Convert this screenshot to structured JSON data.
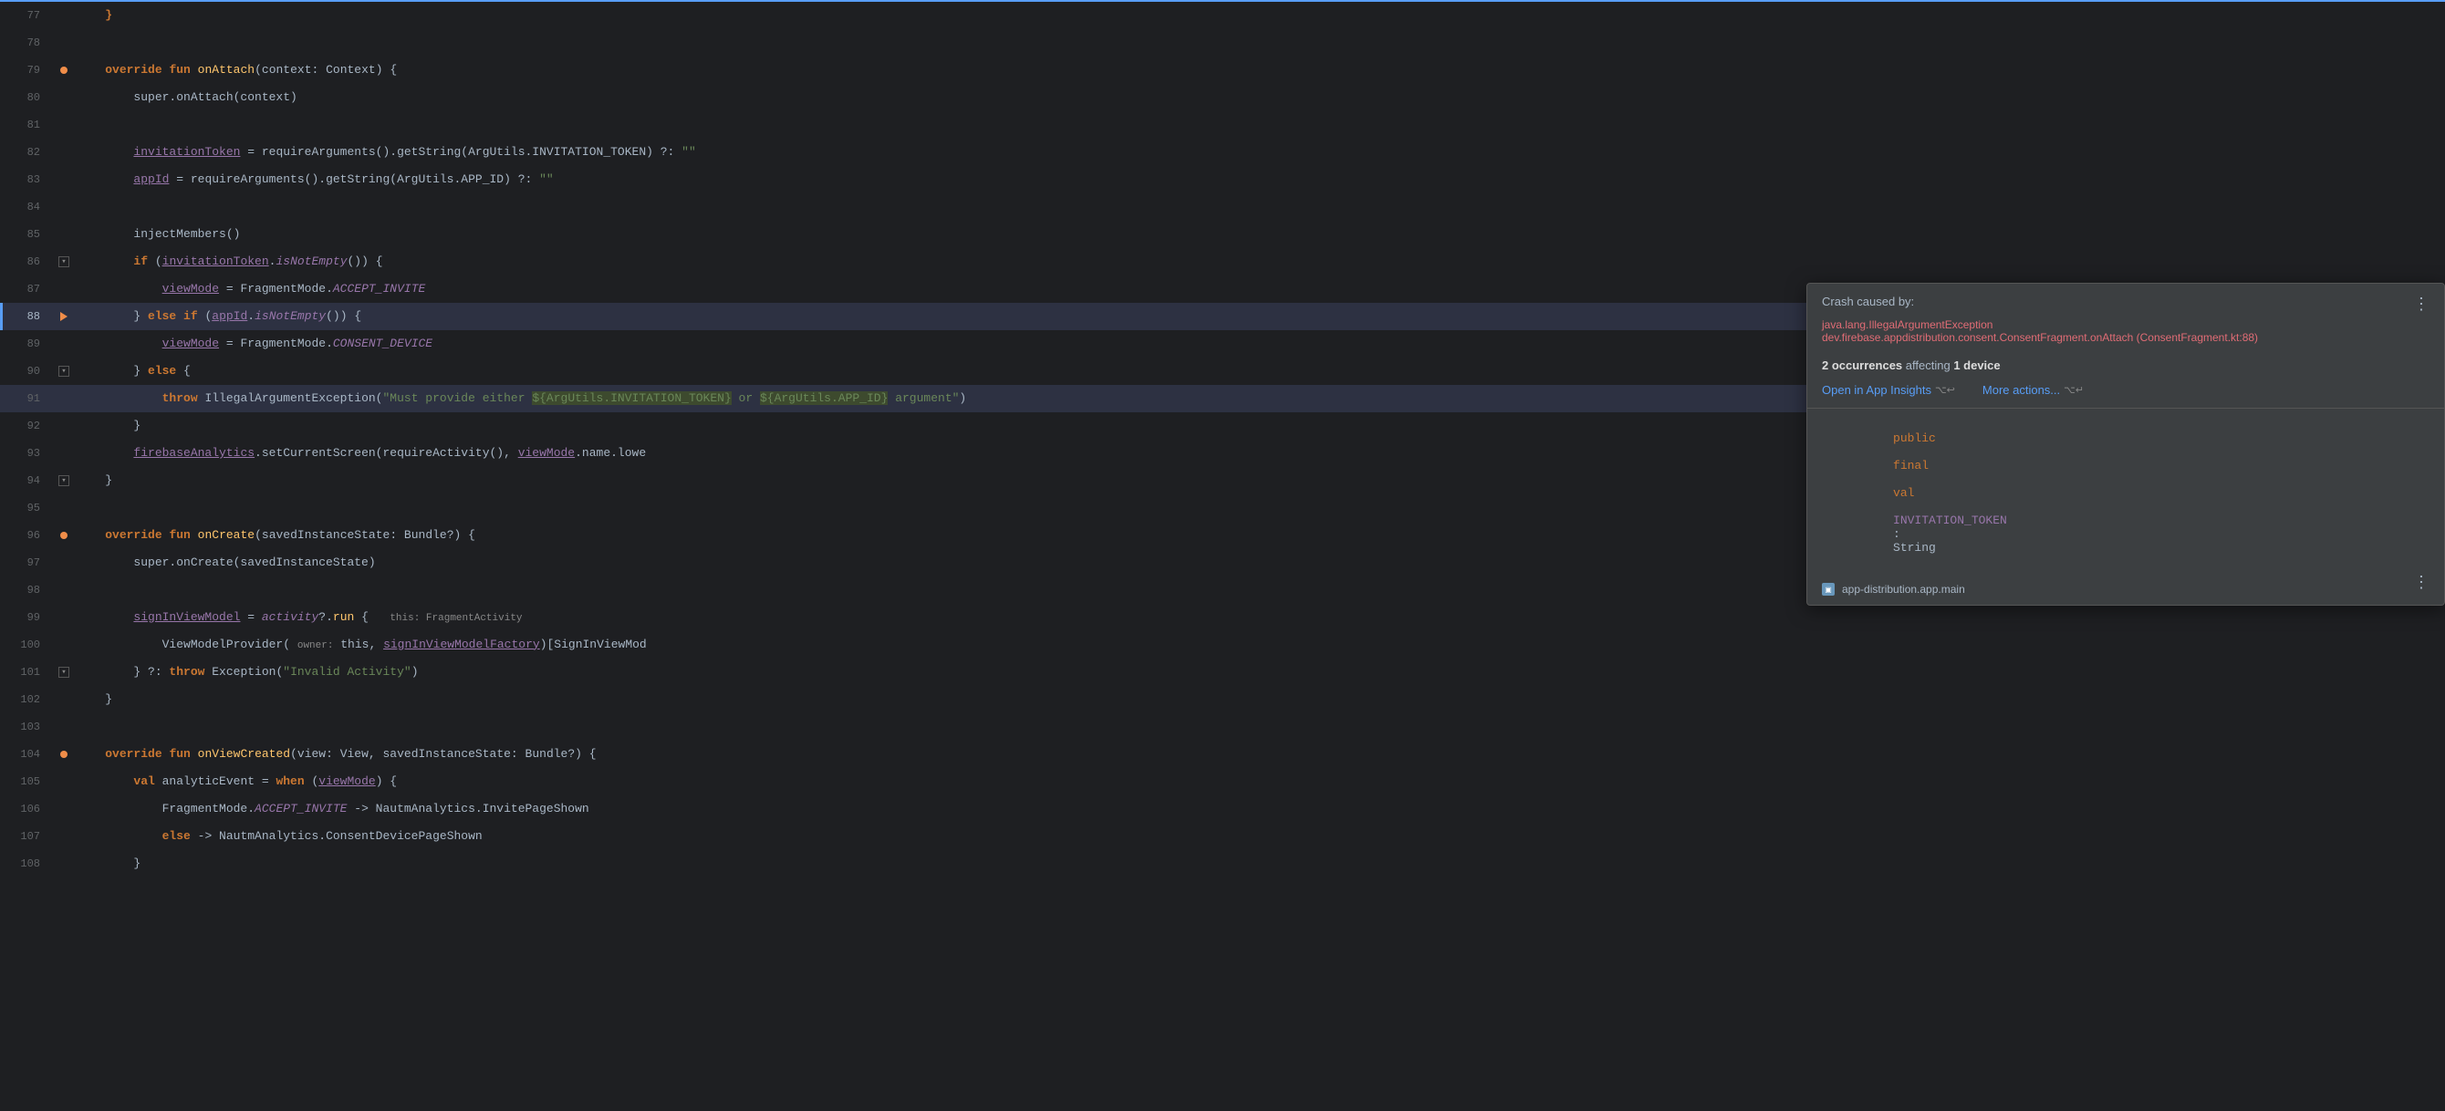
{
  "editor": {
    "lines": [
      {
        "num": "77",
        "gutter": "none",
        "content_html": "    }"
      },
      {
        "num": "78",
        "gutter": "none",
        "content_html": ""
      },
      {
        "num": "79",
        "gutter": "dot-orange",
        "content_html": "    <kw>override</kw> <kw>fun</kw> <fn>onAttach</fn>(context: Context) {"
      },
      {
        "num": "80",
        "gutter": "none",
        "content_html": "        super.onAttach(context)"
      },
      {
        "num": "81",
        "gutter": "none",
        "content_html": ""
      },
      {
        "num": "82",
        "gutter": "none",
        "content_html": "        <var>invitationToken</var> = requireArguments().getString(ArgUtils.INVITATION_TOKEN) ?: \"\""
      },
      {
        "num": "83",
        "gutter": "none",
        "content_html": "        <var>appId</var> = requireArguments().getString(ArgUtils.APP_ID) ?: \"\""
      },
      {
        "num": "84",
        "gutter": "none",
        "content_html": ""
      },
      {
        "num": "85",
        "gutter": "none",
        "content_html": "        injectMembers()"
      },
      {
        "num": "86",
        "gutter": "fold",
        "content_html": "        <kw>if</kw> (<var>invitationToken</var>.<italic>isNotEmpty</italic>()) {"
      },
      {
        "num": "87",
        "gutter": "none",
        "content_html": "            <var>viewMode</var> = FragmentMode.<italic>ACCEPT_INVITE</italic>"
      },
      {
        "num": "88",
        "gutter": "breakpoint",
        "content_html": "        } <kw>else</kw> <kw>if</kw> (<var>appId</var>.<italic>isNotEmpty</italic>()) {",
        "highlight": true
      },
      {
        "num": "89",
        "gutter": "none",
        "content_html": "            <var>viewMode</var> = FragmentMode.<italic>CONSENT_DEVICE</italic>"
      },
      {
        "num": "90",
        "gutter": "fold",
        "content_html": "        } <kw>else</kw> {"
      },
      {
        "num": "91",
        "gutter": "none",
        "content_html": "            <throw>throw</throw> IllegalArgumentException(<str>\"Must provide either ${ArgUtils.INVITATION_TOKEN} or ${ArgUtils.APP_ID} argument\"</str>)",
        "highlight": true
      },
      {
        "num": "92",
        "gutter": "none",
        "content_html": "        }"
      },
      {
        "num": "93",
        "gutter": "none",
        "content_html": "        <var>firebaseAnalytics</var>.setCurrentScreen(requireActivity(), <var>viewMode</var>.name.lowe"
      },
      {
        "num": "94",
        "gutter": "fold",
        "content_html": "    }"
      },
      {
        "num": "95",
        "gutter": "none",
        "content_html": ""
      },
      {
        "num": "96",
        "gutter": "dot-orange",
        "content_html": "    <kw>override</kw> <kw>fun</kw> <fn>onCreate</fn>(savedInstanceState: Bundle?) {"
      },
      {
        "num": "97",
        "gutter": "none",
        "content_html": "        super.onCreate(savedInstanceState)"
      },
      {
        "num": "98",
        "gutter": "none",
        "content_html": ""
      },
      {
        "num": "99",
        "gutter": "none",
        "content_html": "        <var>signInViewModel</var> = <italic>activity</italic>?.<fn>run</fn> {   this: FragmentActivity"
      },
      {
        "num": "100",
        "gutter": "none",
        "content_html": "            ViewModelProvider( owner: this, <var>signInViewModelFactory</var>)[SignInViewModel"
      },
      {
        "num": "101",
        "gutter": "fold",
        "content_html": "        } ?: <kw>throw</kw> Exception(<str>\"Invalid Activity\"</str>)"
      },
      {
        "num": "102",
        "gutter": "none",
        "content_html": "    }"
      },
      {
        "num": "103",
        "gutter": "none",
        "content_html": ""
      },
      {
        "num": "104",
        "gutter": "dot-orange",
        "content_html": "    <kw>override</kw> <kw>fun</kw> <fn>onViewCreated</fn>(view: View, savedInstanceState: Bundle?) {"
      },
      {
        "num": "105",
        "gutter": "none",
        "content_html": "        <kw>val</kw> analyticEvent = <kw>when</kw> (<var>viewMode</var>) {"
      },
      {
        "num": "106",
        "gutter": "none",
        "content_html": "            FragmentMode.<italic>ACCEPT_INVITE</italic> -> NautmAnalytics.InvitePageShown"
      },
      {
        "num": "107",
        "gutter": "none",
        "content_html": "            <kw>else</kw> -> NautmAnalytics.ConsentDevicePageShown"
      },
      {
        "num": "108",
        "gutter": "none",
        "content_html": "        }"
      }
    ],
    "popup": {
      "header_label": "Crash caused by:",
      "crash_line1": "java.lang.IllegalArgumentException",
      "crash_line2": "dev.firebase.appdistribution.consent.ConsentFragment.onAttach (ConsentFragment.kt:88)",
      "occurrences_text": "2 occurrences",
      "affecting_text": " affecting ",
      "device_text": "1 device",
      "link1_label": "Open in App Insights",
      "link1_shortcut": "⌥↩",
      "link2_label": "More actions...",
      "link2_shortcut": "⌥↵",
      "code_line": "public final val INVITATION_TOKEN: String",
      "file_name": "app-distribution.app.main",
      "more_btn1": "⋮",
      "more_btn2": "⋮"
    }
  }
}
